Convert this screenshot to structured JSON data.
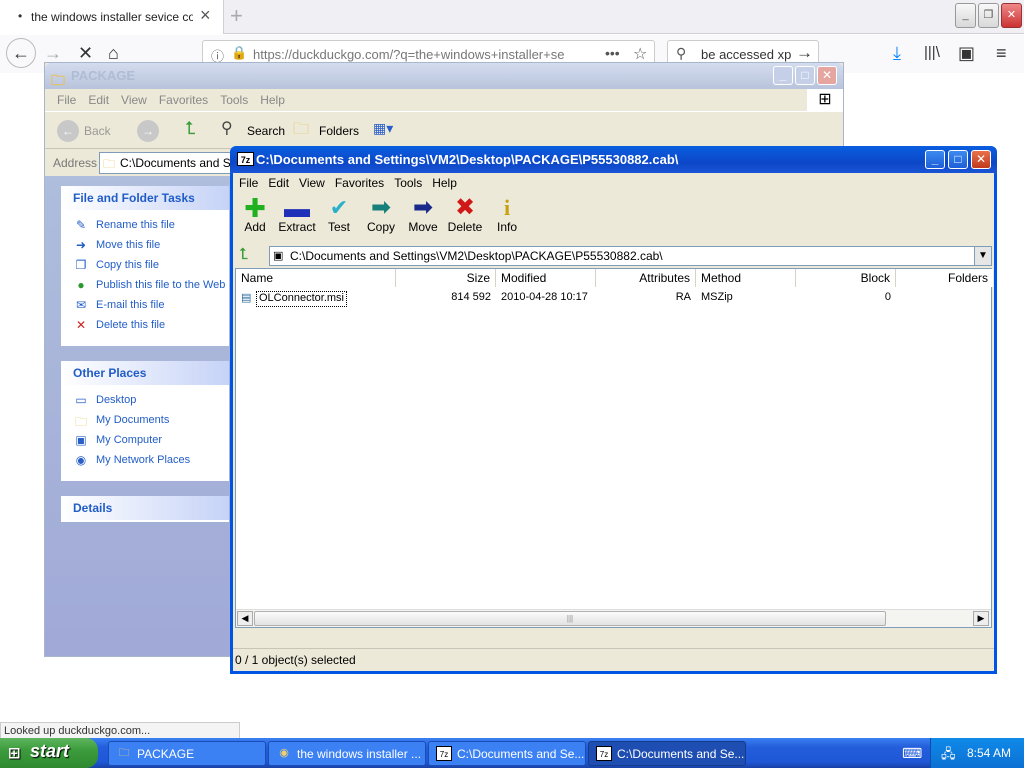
{
  "firefox": {
    "tab_title": "the windows installer sevice could",
    "url": "https://duckduckgo.com/?q=the+windows+installer+se",
    "search_text": "be accessed xp",
    "status": "Looked up duckduckgo.com..."
  },
  "pkg_window": {
    "title": "PACKAGE",
    "menu": [
      "File",
      "Edit",
      "View",
      "Favorites",
      "Tools",
      "Help"
    ],
    "toolbar": {
      "back": "Back",
      "search": "Search",
      "folders": "Folders"
    },
    "address_label": "Address",
    "address_value": "C:\\Documents and Setti",
    "file_tasks": {
      "heading": "File and Folder Tasks",
      "items": [
        "Rename this file",
        "Move this file",
        "Copy this file",
        "Publish this file to the Web",
        "E-mail this file",
        "Delete this file"
      ]
    },
    "other_places": {
      "heading": "Other Places",
      "items": [
        "Desktop",
        "My Documents",
        "My Computer",
        "My Network Places"
      ]
    },
    "details": {
      "heading": "Details"
    }
  },
  "zip_window": {
    "title": "C:\\Documents and Settings\\VM2\\Desktop\\PACKAGE\\P55530882.cab\\",
    "menu": [
      "File",
      "Edit",
      "View",
      "Favorites",
      "Tools",
      "Help"
    ],
    "toolbar": [
      "Add",
      "Extract",
      "Test",
      "Copy",
      "Move",
      "Delete",
      "Info"
    ],
    "path": "C:\\Documents and Settings\\VM2\\Desktop\\PACKAGE\\P55530882.cab\\",
    "columns": [
      "Name",
      "Size",
      "Modified",
      "Attributes",
      "Method",
      "Block",
      "Folders"
    ],
    "rows": [
      {
        "name": "OLConnector.msi",
        "size": "814 592",
        "modified": "2010-04-28 10:17",
        "attributes": "RA",
        "method": "MSZip",
        "block": "0"
      }
    ],
    "status": "0 / 1 object(s) selected"
  },
  "taskbar": {
    "start": "start",
    "buttons": [
      "PACKAGE",
      "the windows installer ...",
      "C:\\Documents and Se...",
      "C:\\Documents and Se..."
    ],
    "clock": "8:54 AM"
  }
}
